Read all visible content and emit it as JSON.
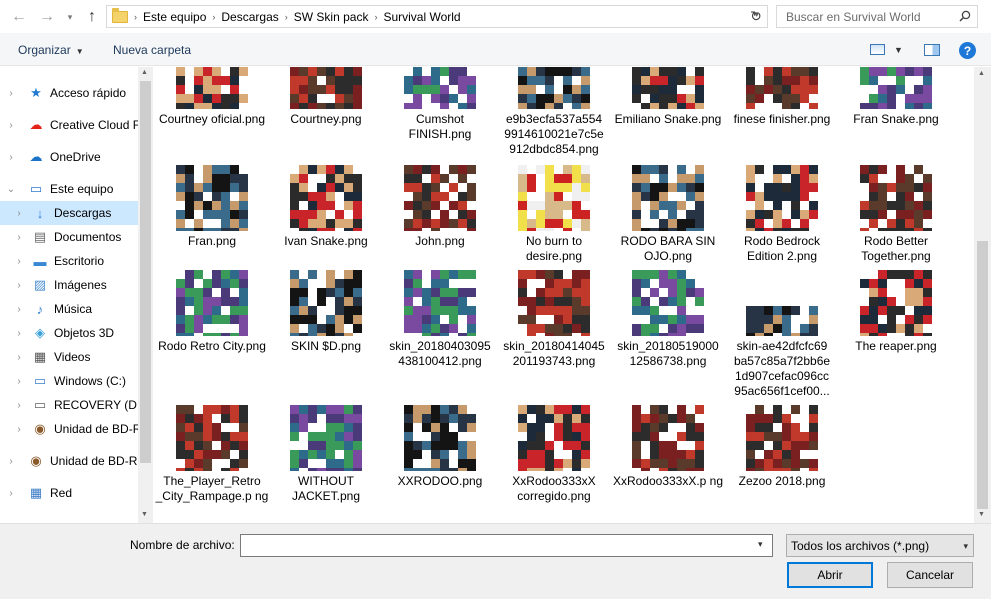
{
  "address": {
    "crumbs": [
      "Este equipo",
      "Descargas",
      "SW Skin pack",
      "Survival World"
    ],
    "search_placeholder": "Buscar en Survival World"
  },
  "toolbar": {
    "organize_label": "Organizar",
    "new_folder_label": "Nueva carpeta"
  },
  "nav": {
    "items": [
      {
        "label": "Acceso rápido",
        "icon": "star-icon",
        "level": 0,
        "expander": "›"
      },
      {
        "label": "Creative Cloud Fil",
        "icon": "creative-cloud-icon",
        "level": 0,
        "expander": "›"
      },
      {
        "label": "OneDrive",
        "icon": "onedrive-icon",
        "level": 0,
        "expander": "›"
      },
      {
        "label": "Este equipo",
        "icon": "computer-icon",
        "level": 0,
        "expander": "⌄"
      },
      {
        "label": "Descargas",
        "icon": "downloads-icon",
        "level": 1,
        "expander": "›",
        "selected": true
      },
      {
        "label": "Documentos",
        "icon": "documents-icon",
        "level": 1,
        "expander": "›"
      },
      {
        "label": "Escritorio",
        "icon": "desktop-icon",
        "level": 1,
        "expander": "›"
      },
      {
        "label": "Imágenes",
        "icon": "pictures-icon",
        "level": 1,
        "expander": "›"
      },
      {
        "label": "Música",
        "icon": "music-icon",
        "level": 1,
        "expander": "›"
      },
      {
        "label": "Objetos 3D",
        "icon": "3d-objects-icon",
        "level": 1,
        "expander": "›"
      },
      {
        "label": "Videos",
        "icon": "videos-icon",
        "level": 1,
        "expander": "›"
      },
      {
        "label": "Windows (C:)",
        "icon": "windows-drive-icon",
        "level": 1,
        "expander": "›"
      },
      {
        "label": "RECOVERY (D:)",
        "icon": "drive-icon",
        "level": 1,
        "expander": "›"
      },
      {
        "label": "Unidad de BD-R",
        "icon": "bd-drive-icon",
        "level": 1,
        "expander": "›"
      },
      {
        "label": "Unidad de BD-RO",
        "icon": "bd-drive-icon",
        "level": 0,
        "expander": "›"
      },
      {
        "label": "Red",
        "icon": "network-icon",
        "level": 0,
        "expander": "›"
      }
    ]
  },
  "files": [
    {
      "name": "Courtney oficial.png"
    },
    {
      "name": "Courtney.png"
    },
    {
      "name": "Cumshot FINISH.png"
    },
    {
      "name": "e9b3ecfa537a554 9914610021e7c5e 912dbdc854.png"
    },
    {
      "name": "Emiliano Snake.png"
    },
    {
      "name": "finese finisher.png"
    },
    {
      "name": "Fran Snake.png"
    },
    {
      "name": "Fran.png"
    },
    {
      "name": "Ivan Snake.png"
    },
    {
      "name": "John.png"
    },
    {
      "name": "No burn to desire.png"
    },
    {
      "name": "RODO BARA SIN OJO.png"
    },
    {
      "name": "Rodo Bedrock Edition 2.png"
    },
    {
      "name": "Rodo Better Together.png"
    },
    {
      "name": "Rodo Retro City.png"
    },
    {
      "name": "SKIN $D.png"
    },
    {
      "name": "skin_20180403095 438100412.png"
    },
    {
      "name": "skin_20180414045 201193743.png"
    },
    {
      "name": "skin_20180519000 12586738.png"
    },
    {
      "name": "skin-ae42dfcfc69 ba57c85a7f2bb6e 1d907cefac096cc 95ac656f1cef00..."
    },
    {
      "name": "The reaper.png"
    },
    {
      "name": "The_Player_Retro _City_Rampage.p ng"
    },
    {
      "name": "WITHOUT JACKET.png"
    },
    {
      "name": "XXRODOO.png"
    },
    {
      "name": "XxRodoo333xX corregido.png"
    },
    {
      "name": "XxRodoo333xX.p ng"
    },
    {
      "name": "Zezoo 2018.png"
    }
  ],
  "bottom": {
    "filename_label": "Nombre de archivo:",
    "filename_value": "",
    "filter_value": "Todos los archivos (*.png)",
    "open_label": "Abrir",
    "cancel_label": "Cancelar"
  },
  "colors": {
    "selection": "#cce8ff",
    "accent": "#0078d7"
  }
}
